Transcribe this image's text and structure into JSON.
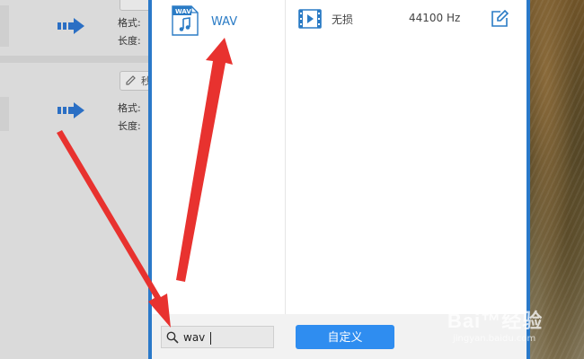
{
  "background_app": {
    "rows": [
      {
        "format_label": "格式:",
        "length_label": "长度:",
        "edit_text": ""
      },
      {
        "format_label": "格式:",
        "length_label": "长度:",
        "edit_text": "秒"
      }
    ]
  },
  "format_list": {
    "item": {
      "icon_text": "WAV",
      "name": "WAV",
      "quality": "无损",
      "sample_rate": "44100 Hz"
    }
  },
  "bottom_bar": {
    "search_value": "wav",
    "custom_button_label": "自定义"
  },
  "watermark": {
    "main": "Bai™经验",
    "sub": "jingyan.baidu.com"
  },
  "colors": {
    "dialog_border": "#2a79c9",
    "accent": "#2f8df0",
    "format_name": "#2a7bc5",
    "annotation_arrow": "#e8322f"
  }
}
